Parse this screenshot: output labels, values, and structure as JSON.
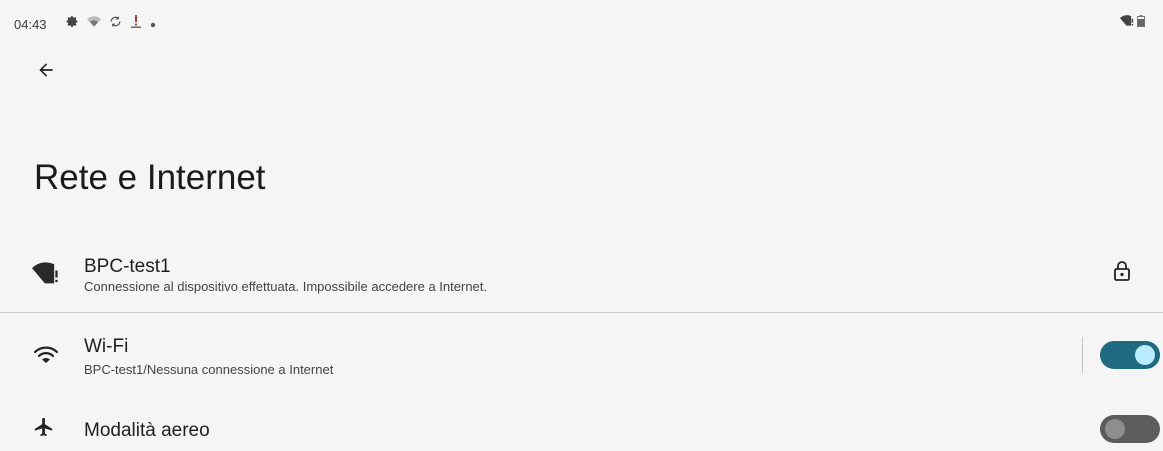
{
  "status_bar": {
    "time": "04:43",
    "icons": [
      "settings-gear-icon",
      "wifi-weak-icon",
      "sync-icon",
      "download-alert-icon",
      "notification-dot-icon"
    ],
    "right_icons": [
      "wifi-no-internet-icon",
      "battery-icon"
    ]
  },
  "header": {
    "back_icon": "arrow-left-icon",
    "title": "Rete e Internet"
  },
  "network_item": {
    "icon": "wifi-no-internet-icon",
    "title": "BPC-test1",
    "subtitle": "Connessione al dispositivo effettuata. Impossibile accedere a Internet.",
    "trailing_icon": "lock-icon"
  },
  "wifi_item": {
    "icon": "wifi-icon",
    "title": "Wi-Fi",
    "subtitle": "BPC-test1/Nessuna connessione a Internet",
    "toggle_on": true
  },
  "airplane_item": {
    "icon": "airplane-icon",
    "title": "Modalità aereo",
    "toggle_on": false
  },
  "colors": {
    "background": "#f5f5f5",
    "toggle_on_track": "#1e6a80",
    "toggle_on_knob": "#b8ecff",
    "toggle_off_track": "#5c5c5c"
  }
}
